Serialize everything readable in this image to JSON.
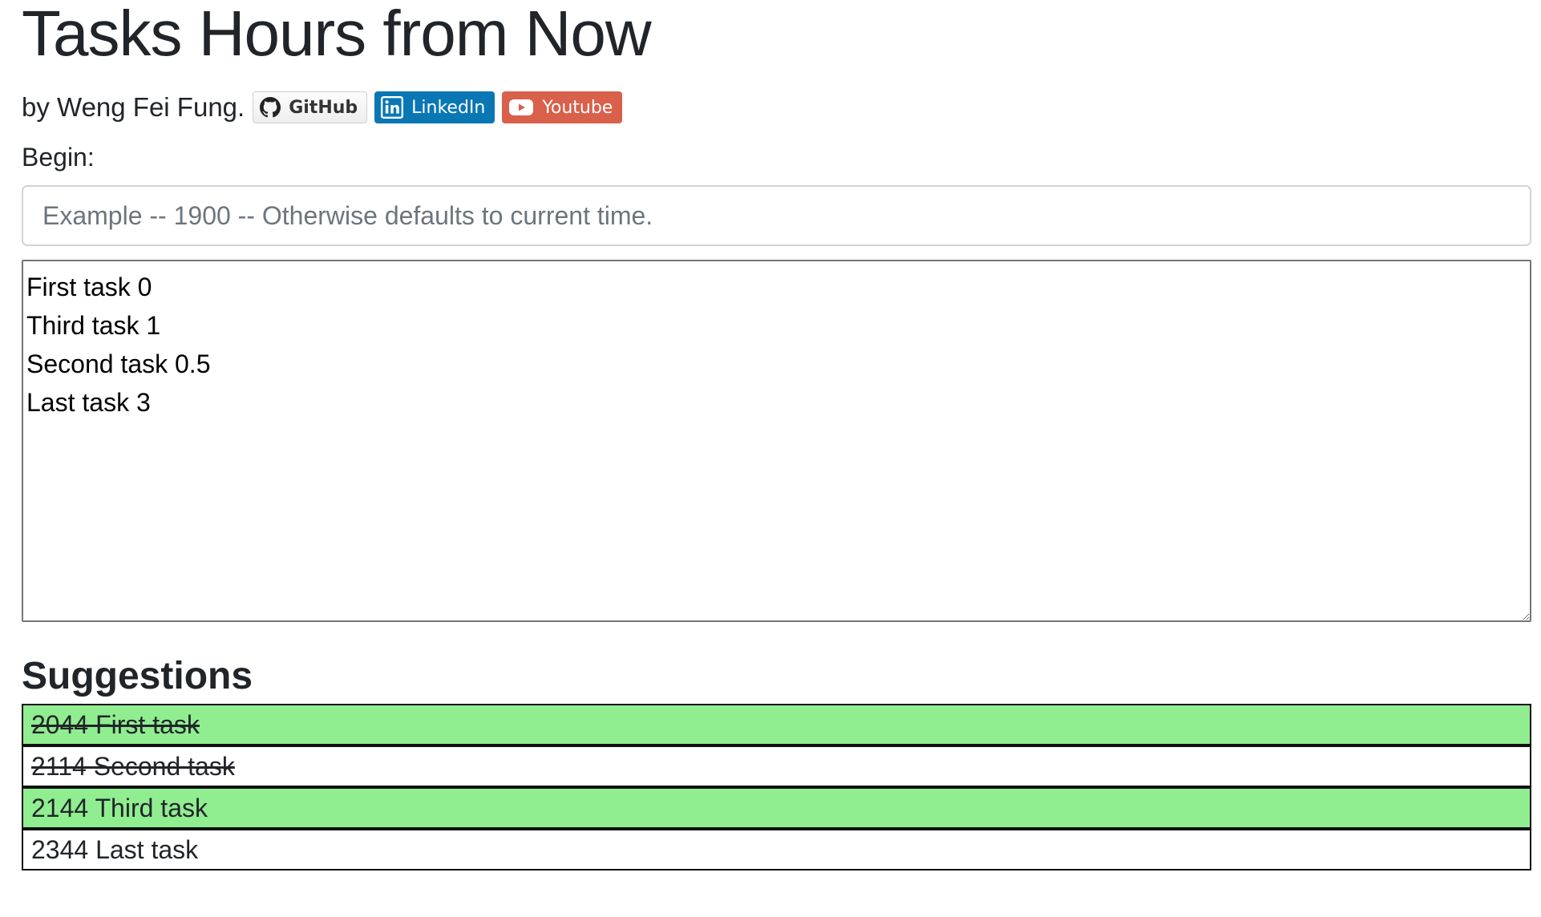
{
  "page": {
    "title": "Tasks Hours from Now",
    "byline": "by Weng Fei Fung."
  },
  "badges": [
    {
      "label": "GitHub",
      "icon": "github-icon",
      "color": "#eeeeee"
    },
    {
      "label": "LinkedIn",
      "icon": "linkedin-icon",
      "color": "#0a77b5"
    },
    {
      "label": "Youtube",
      "icon": "youtube-icon",
      "color": "#d9604a"
    }
  ],
  "begin": {
    "label": "Begin:",
    "value": "",
    "placeholder": "Example -- 1900 -- Otherwise defaults to current time."
  },
  "tasks": {
    "value": "First task 0\nThird task 1\nSecond task 0.5\nLast task 3"
  },
  "suggestions": {
    "title": "Suggestions",
    "items": [
      {
        "text": "2044 First task",
        "done": true,
        "highlight": true
      },
      {
        "text": "2114 Second task",
        "done": true,
        "highlight": false
      },
      {
        "text": "2144 Third task",
        "done": false,
        "highlight": true
      },
      {
        "text": "2344 Last task",
        "done": false,
        "highlight": false
      }
    ]
  },
  "colors": {
    "highlight": "#90ee90",
    "text": "#212529",
    "row_border": "#111111"
  }
}
